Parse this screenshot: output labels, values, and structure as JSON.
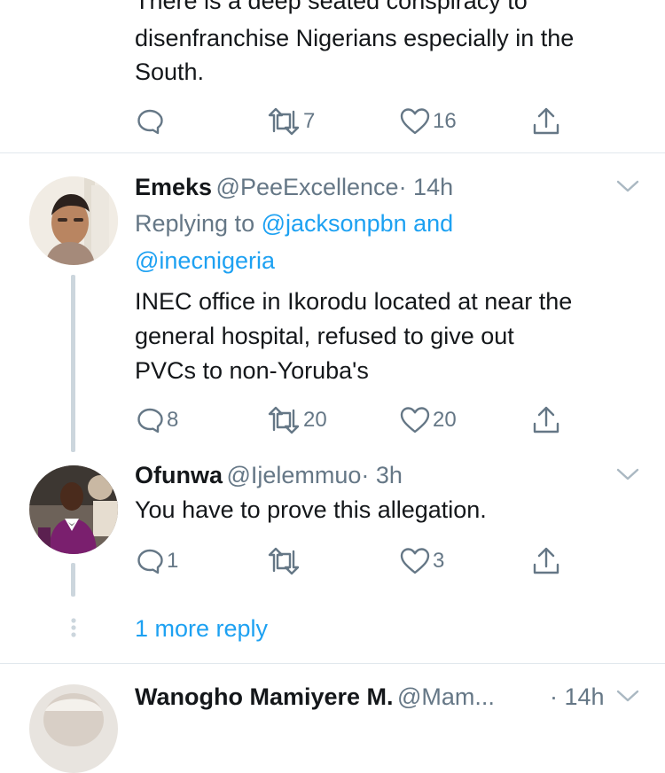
{
  "tweet_top": {
    "text_lines": [
      "There is a deep seated conspiracy to",
      "disenfranchise Nigerians especially in the",
      "South."
    ],
    "reply_count": "",
    "retweet_count": "7",
    "like_count": "16"
  },
  "reply1": {
    "name": "Emeks",
    "handle": "@PeeExcellence",
    "time": "· 14h",
    "replying_prefix": "Replying to",
    "replying_user1": "@jacksonpbn",
    "replying_and": "and",
    "replying_user2": "@inecnigeria",
    "text_lines": [
      "INEC office in Ikorodu located at near the",
      "general hospital, refused to give out",
      "PVCs to non-Yoruba's"
    ],
    "reply_count": "8",
    "retweet_count": "20",
    "like_count": "20"
  },
  "reply2": {
    "name": "Ofunwa",
    "handle": "@Ijelemmuo",
    "time": "· 3h",
    "text_lines": [
      "You have to prove this allegation."
    ],
    "reply_count": "1",
    "retweet_count": "",
    "like_count": "3"
  },
  "more_replies": {
    "label": "1 more reply"
  },
  "reply3": {
    "name": "Wanogho Mamiyere M.",
    "handle": "@Mam...",
    "time": "· 14h"
  },
  "icons": {
    "reply": "reply-icon",
    "retweet": "retweet-icon",
    "like": "heart-icon",
    "share": "share-icon",
    "chevron": "chevron-down-icon"
  },
  "colors": {
    "text": "#14171a",
    "secondary": "#657786",
    "link": "#1da1f2",
    "divider": "#e1e8ed",
    "thread_line": "#ccd6dd"
  }
}
